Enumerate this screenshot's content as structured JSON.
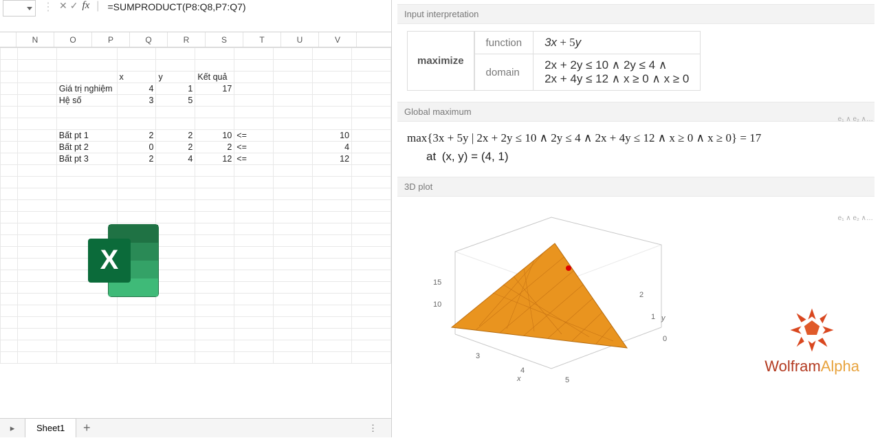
{
  "excel": {
    "namebox": "",
    "formula": "=SUMPRODUCT(P8:Q8,P7:Q7)",
    "columns": [
      "",
      "N",
      "O",
      "P",
      "Q",
      "R",
      "S",
      "T",
      "U",
      "V"
    ],
    "rows": [
      {
        "cells": [
          "",
          "",
          "",
          "",
          "",
          "",
          "",
          "",
          "",
          ""
        ]
      },
      {
        "cells": [
          "",
          "",
          "",
          "",
          "",
          "",
          "",
          "",
          "",
          ""
        ]
      },
      {
        "cells": [
          "",
          "",
          "",
          "x",
          "y",
          "Kết quả",
          "",
          "",
          "",
          ""
        ],
        "align": [
          "",
          "",
          "",
          "l",
          "l",
          "l",
          "",
          "",
          "",
          ""
        ]
      },
      {
        "cells": [
          "",
          "",
          "Giá trị nghiệm",
          "4",
          "1",
          "17",
          "",
          "",
          "",
          ""
        ],
        "align": [
          "",
          "",
          "l",
          "",
          "",
          "",
          "",
          "",
          "",
          ""
        ]
      },
      {
        "cells": [
          "",
          "",
          "Hệ số",
          "3",
          "5",
          "",
          "",
          "",
          "",
          ""
        ],
        "align": [
          "",
          "",
          "l",
          "",
          "",
          "",
          "",
          "",
          "",
          ""
        ]
      },
      {
        "cells": [
          "",
          "",
          "",
          "",
          "",
          "",
          "",
          "",
          "",
          ""
        ]
      },
      {
        "cells": [
          "",
          "",
          "",
          "",
          "",
          "",
          "",
          "",
          "",
          ""
        ]
      },
      {
        "cells": [
          "",
          "",
          "Bất pt 1",
          "2",
          "2",
          "10",
          "<=",
          "",
          "10",
          ""
        ],
        "align": [
          "",
          "",
          "l",
          "",
          "",
          "",
          "l",
          "",
          "",
          ""
        ]
      },
      {
        "cells": [
          "",
          "",
          "Bất pt 2",
          "0",
          "2",
          "2",
          "<=",
          "",
          "4",
          ""
        ],
        "align": [
          "",
          "",
          "l",
          "",
          "",
          "",
          "l",
          "",
          "",
          ""
        ]
      },
      {
        "cells": [
          "",
          "",
          "Bất pt 3",
          "2",
          "4",
          "12",
          "<=",
          "",
          "12",
          ""
        ],
        "align": [
          "",
          "",
          "l",
          "",
          "",
          "",
          "l",
          "",
          "",
          ""
        ]
      },
      {
        "cells": [
          "",
          "",
          "",
          "",
          "",
          "",
          "",
          "",
          "",
          ""
        ]
      },
      {
        "cells": [
          "",
          "",
          "",
          "",
          "",
          "",
          "",
          "",
          "",
          ""
        ]
      },
      {
        "cells": [
          "",
          "",
          "",
          "",
          "",
          "",
          "",
          "",
          "",
          ""
        ]
      },
      {
        "cells": [
          "",
          "",
          "",
          "",
          "",
          "",
          "",
          "",
          "",
          ""
        ]
      },
      {
        "cells": [
          "",
          "",
          "",
          "",
          "",
          "",
          "",
          "",
          "",
          ""
        ]
      },
      {
        "cells": [
          "",
          "",
          "",
          "",
          "",
          "",
          "",
          "",
          "",
          ""
        ]
      },
      {
        "cells": [
          "",
          "",
          "",
          "",
          "",
          "",
          "",
          "",
          "",
          ""
        ]
      },
      {
        "cells": [
          "",
          "",
          "",
          "",
          "",
          "",
          "",
          "",
          "",
          ""
        ]
      },
      {
        "cells": [
          "",
          "",
          "",
          "",
          "",
          "",
          "",
          "",
          "",
          ""
        ]
      },
      {
        "cells": [
          "",
          "",
          "",
          "",
          "",
          "",
          "",
          "",
          "",
          ""
        ]
      },
      {
        "cells": [
          "",
          "",
          "",
          "",
          "",
          "",
          "",
          "",
          "",
          ""
        ]
      },
      {
        "cells": [
          "",
          "",
          "",
          "",
          "",
          "",
          "",
          "",
          "",
          ""
        ]
      },
      {
        "cells": [
          "",
          "",
          "",
          "",
          "",
          "",
          "",
          "",
          "",
          ""
        ]
      },
      {
        "cells": [
          "",
          "",
          "",
          "",
          "",
          "",
          "",
          "",
          "",
          ""
        ]
      },
      {
        "cells": [
          "",
          "",
          "",
          "",
          "",
          "",
          "",
          "",
          "",
          ""
        ]
      },
      {
        "cells": [
          "",
          "",
          "",
          "",
          "",
          "",
          "",
          "",
          "",
          ""
        ]
      },
      {
        "cells": [
          "",
          "",
          "",
          "",
          "",
          "",
          "",
          "",
          "",
          ""
        ]
      }
    ],
    "sheet_tab": "Sheet1"
  },
  "wolfram": {
    "pod1_title": "Input interpretation",
    "keyword": "maximize",
    "label_function": "function",
    "label_domain": "domain",
    "func": "3x + 5y",
    "domain_line1": "2x + 2y ≤ 10 ∧ 2y ≤ 4 ∧",
    "domain_line2": "2x + 4y ≤ 12 ∧ x ≥ 0 ∧ x ≥ 0",
    "corner1": "e₁ ∧ e₂ ∧…",
    "pod2_title": "Global maximum",
    "max_expr": "max{3x + 5y | 2x + 2y ≤ 10 ∧ 2y ≤ 4 ∧ 2x + 4y ≤ 12 ∧ x ≥ 0 ∧ x ≥ 0} = 17",
    "at_label": "at",
    "at_point": "(x, y) = (4, 1)",
    "corner2": "e₁ ∧ e₂ ∧…",
    "pod3_title": "3D plot",
    "brand_w": "Wolfram",
    "brand_a": "Alpha",
    "axis_z": [
      "15",
      "10"
    ],
    "axis_x": [
      "3",
      "4",
      "5"
    ],
    "axis_y": [
      "0",
      "1",
      "2"
    ],
    "axis_x_label": "x",
    "axis_y_label": "y"
  }
}
